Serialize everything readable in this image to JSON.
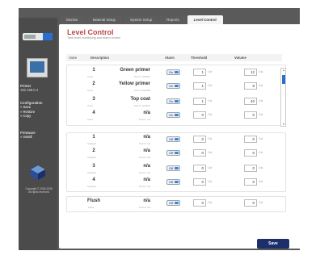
{
  "tabs": [
    "Monitor",
    "Material Setup",
    "System Setup",
    "Reports",
    "Level Control"
  ],
  "sidebar": {
    "device_name": "Printer",
    "device_ip": "192.168.0.4",
    "configuration": {
      "title": "Configuration",
      "items": [
        "» Save",
        "» Restore",
        "» Copy"
      ]
    },
    "firmware": {
      "title": "Firmware",
      "items": [
        "» Install"
      ]
    },
    "copyright_1": "Copyright © 2006-2008",
    "copyright_2": "All rights reserved"
  },
  "page": {
    "title": "Level Control",
    "subtitle": "Tank level monitoring and alarm control"
  },
  "headers": {
    "valve": "Valve",
    "description": "Description",
    "alarm": "Alarm",
    "threshold": "Threshold",
    "volume": "Volume"
  },
  "units": {
    "threshold": "Gal",
    "volume": "Gal"
  },
  "rows": [
    {
      "num": "1",
      "sub": "Color",
      "name": "Green primer",
      "pn": "Part #: 10345A",
      "alarm": "On",
      "threshold": "1",
      "volume": "12"
    },
    {
      "num": "2",
      "sub": "Color",
      "name": "Yellow primer",
      "pn": "Part #: 10345B",
      "alarm": "On",
      "threshold": "1",
      "volume": "8"
    },
    {
      "num": "3",
      "sub": "Color",
      "name": "Top coat",
      "pn": "Part #: 10345C",
      "alarm": "On",
      "threshold": "1",
      "volume": "10"
    },
    {
      "num": "4",
      "sub": "Color",
      "name": "n/a",
      "pn": "Part #: n/a",
      "alarm": "On",
      "threshold": "0",
      "volume": "0"
    },
    {
      "num": "1",
      "sub": "Catalyst",
      "name": "n/a",
      "pn": "Part #: n/a",
      "alarm": "Off",
      "threshold": "0",
      "volume": "0"
    },
    {
      "num": "2",
      "sub": "Catalyst",
      "name": "n/a",
      "pn": "Part #: n/a",
      "alarm": "Off",
      "threshold": "0",
      "volume": "0"
    },
    {
      "num": "3",
      "sub": "Catalyst",
      "name": "n/a",
      "pn": "Part #: n/a",
      "alarm": "Off",
      "threshold": "0",
      "volume": "0"
    },
    {
      "num": "4",
      "sub": "Catalyst",
      "name": "n/a",
      "pn": "Part #: n/a",
      "alarm": "Off",
      "threshold": "0",
      "volume": "0"
    },
    {
      "num": "Flush",
      "sub": "Flush",
      "name": "n/a",
      "pn": "Part #: n/a",
      "alarm": "Off",
      "threshold": "0",
      "volume": "0"
    }
  ],
  "save_label": "Save",
  "colors": {
    "title": "#c04848",
    "save_button": "#1d2f6a",
    "accent": "#2a6fd0"
  }
}
